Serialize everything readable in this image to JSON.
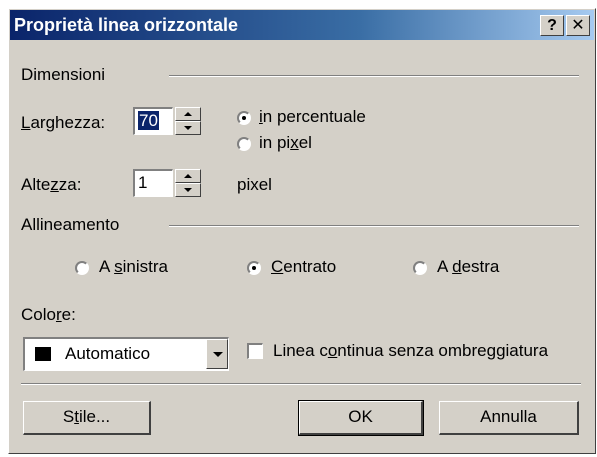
{
  "window": {
    "title": "Proprietà linea orizzontale",
    "help_label": "?",
    "close_label": "✕"
  },
  "dimensioni": {
    "group_label": "Dimensioni",
    "width_label": "Larghezza:",
    "width_value": "70",
    "height_label": "Altezza:",
    "height_value": "1",
    "unit_percent": "in percentuale",
    "unit_pixel": "in pixel",
    "height_unit": "pixel",
    "selected_unit": "in percentuale"
  },
  "allineamento": {
    "group_label": "Allineamento",
    "options": [
      "A sinistra",
      "Centrato",
      "A destra"
    ],
    "selected": "Centrato"
  },
  "colore": {
    "label": "Colore:",
    "value": "Automatico",
    "swatch_color": "#000000",
    "noshade_label": "Linea continua senza ombreggiatura",
    "noshade_checked": false
  },
  "buttons": {
    "style": "Stile...",
    "ok": "OK",
    "cancel": "Annulla"
  }
}
